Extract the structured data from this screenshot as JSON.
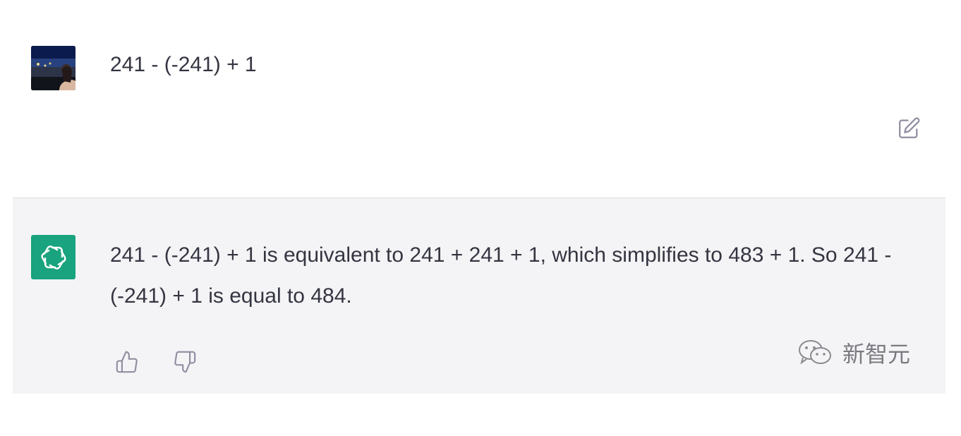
{
  "conversation": {
    "user_message": {
      "avatar": "user-photo-avatar",
      "text": "241 - (-241) + 1",
      "edit_icon": "edit-pencil-icon"
    },
    "assistant_message": {
      "avatar": "openai-logo-icon",
      "text": "241 - (-241) + 1 is equivalent to 241 + 241 + 1, which simplifies to 483 + 1. So 241 - (-241) + 1 is equal to 484.",
      "feedback": {
        "thumbs_up_icon": "thumbs-up-icon",
        "thumbs_down_icon": "thumbs-down-icon"
      }
    }
  },
  "watermark": {
    "icon": "wechat-icon",
    "text": "新智元"
  },
  "colors": {
    "assistant_bg": "#f4f4f6",
    "assistant_avatar": "#19a37e",
    "text": "#343541",
    "icon": "#8e8ea0"
  }
}
